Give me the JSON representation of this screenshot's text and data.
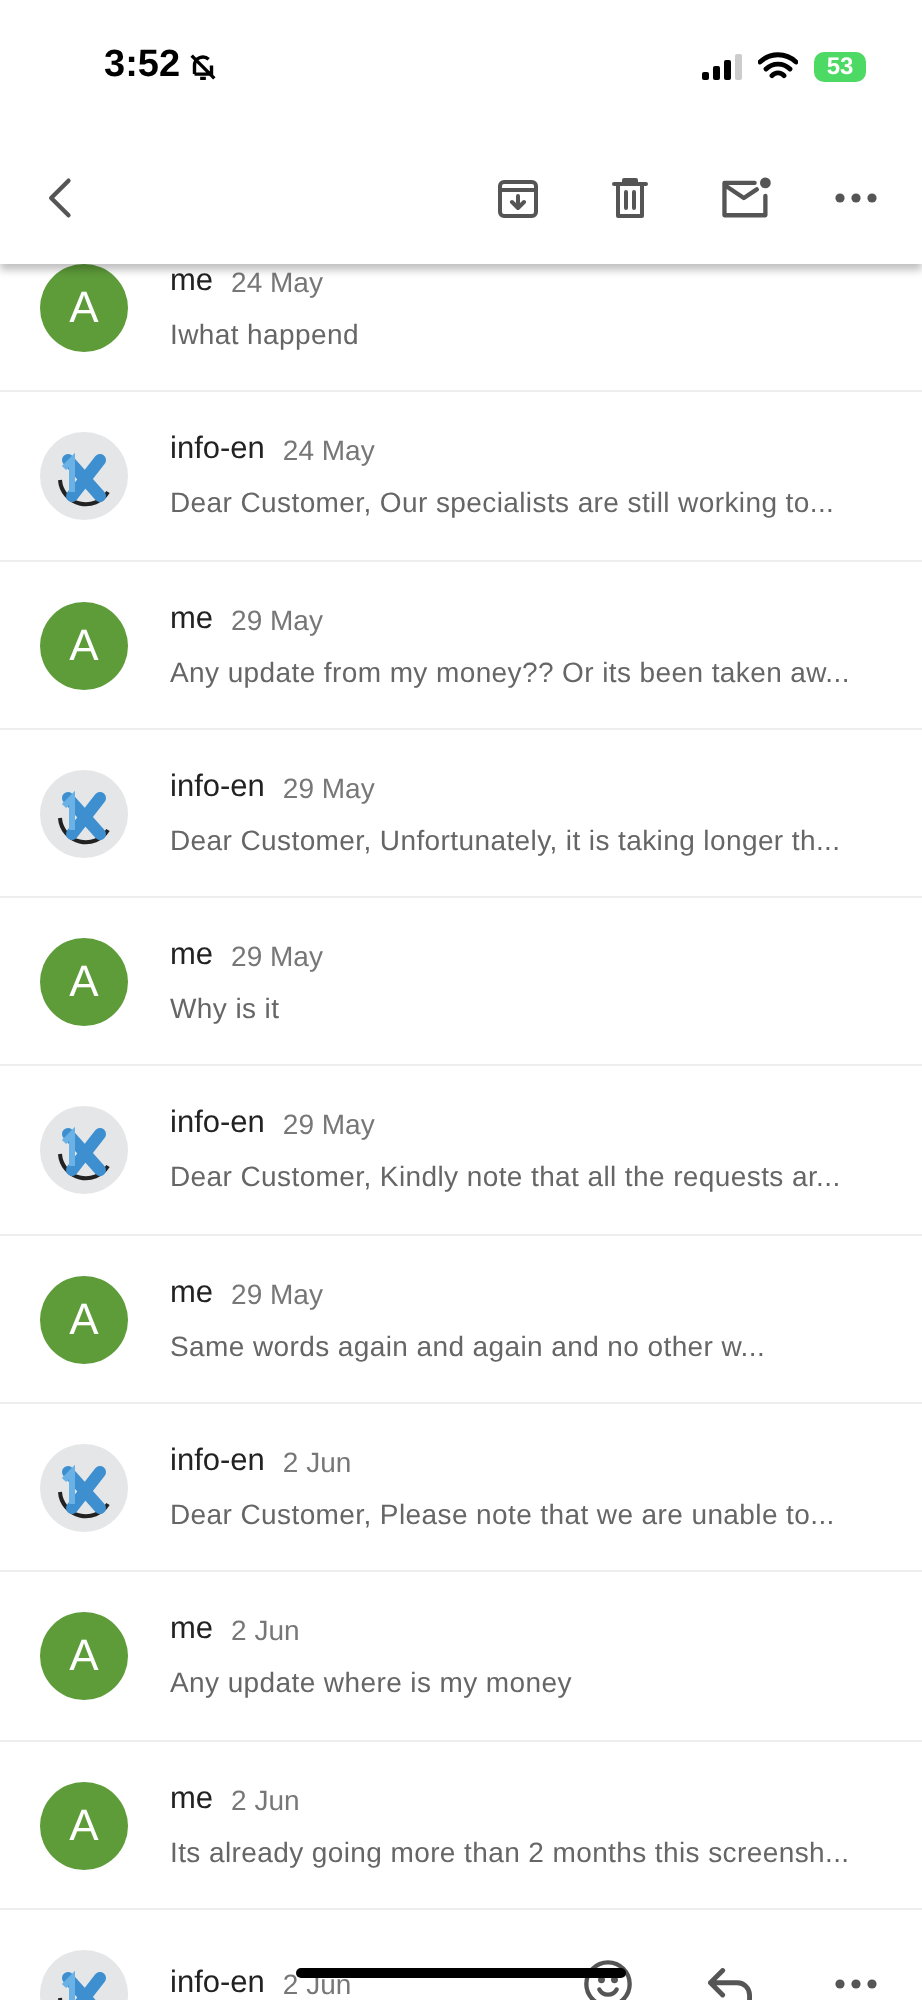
{
  "status_bar": {
    "time": "3:52",
    "battery": "53"
  },
  "messages": [
    {
      "sender": "me",
      "date": "24 May",
      "snippet": "Iwhat happend",
      "avatar": {
        "kind": "letter",
        "letter": "A",
        "color": "#5e9c3a"
      }
    },
    {
      "sender": "info-en",
      "date": "24 May",
      "snippet": "Dear Customer, Our specialists are still working to...",
      "avatar": {
        "kind": "logo"
      }
    },
    {
      "sender": "me",
      "date": "29 May",
      "snippet": "Any update from my money?? Or its been taken aw...",
      "avatar": {
        "kind": "letter",
        "letter": "A",
        "color": "#5e9c3a"
      }
    },
    {
      "sender": "info-en",
      "date": "29 May",
      "snippet": "Dear Customer, Unfortunately, it is taking longer th...",
      "avatar": {
        "kind": "logo"
      }
    },
    {
      "sender": "me",
      "date": "29 May",
      "snippet": "Why is it",
      "avatar": {
        "kind": "letter",
        "letter": "A",
        "color": "#5e9c3a"
      }
    },
    {
      "sender": "info-en",
      "date": "29 May",
      "snippet": "Dear Customer, Kindly note that all the requests ar...",
      "avatar": {
        "kind": "logo"
      }
    },
    {
      "sender": "me",
      "date": "29 May",
      "snippet": "Same words again and again and no other w...",
      "avatar": {
        "kind": "letter",
        "letter": "A",
        "color": "#5e9c3a"
      }
    },
    {
      "sender": "info-en",
      "date": "2 Jun",
      "snippet": "Dear Customer, Please note that we are unable to...",
      "avatar": {
        "kind": "logo"
      }
    },
    {
      "sender": "me",
      "date": "2 Jun",
      "snippet": "Any update where is my money",
      "avatar": {
        "kind": "letter",
        "letter": "A",
        "color": "#5e9c3a"
      }
    },
    {
      "sender": "me",
      "date": "2 Jun",
      "snippet": "Its already going more than 2 months this screensh...",
      "avatar": {
        "kind": "letter",
        "letter": "A",
        "color": "#5e9c3a"
      }
    },
    {
      "sender": "info-en",
      "date": "2 Jun",
      "avatar": {
        "kind": "logo"
      },
      "expanded": true
    }
  ]
}
